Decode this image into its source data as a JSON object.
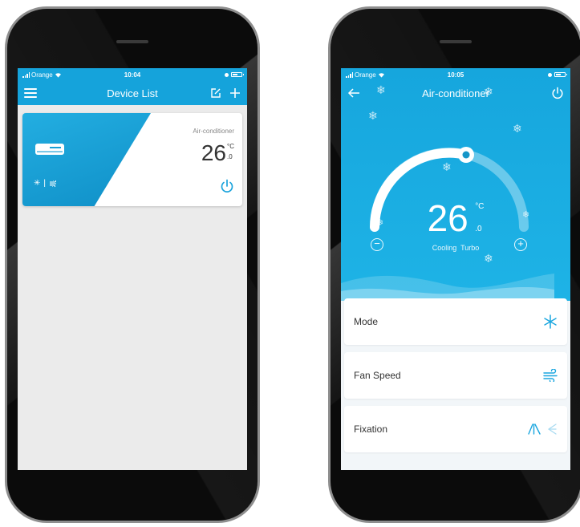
{
  "device_list_screen": {
    "status": {
      "carrier": "Orange",
      "time": "10:04"
    },
    "nav": {
      "title": "Device List"
    },
    "device_card": {
      "name": "Air-conditioner",
      "temp": "26",
      "unit": "°C",
      "decimal": ".0",
      "modes_separator": "|"
    }
  },
  "detail_screen": {
    "status": {
      "carrier": "Orange",
      "time": "10:05"
    },
    "nav": {
      "title": "Air-conditioner"
    },
    "thermostat": {
      "temp": "26",
      "unit": "°C",
      "decimal": ".0",
      "mode_text": "Cooling  Turbo",
      "decrease_label": "−",
      "increase_label": "+"
    },
    "settings": [
      {
        "label": "Mode",
        "icon": "snowflake-icon"
      },
      {
        "label": "Fan Speed",
        "icon": "wind-icon"
      },
      {
        "label": "Fixation",
        "icon": "swing-icon"
      }
    ]
  },
  "colors": {
    "accent": "#15a3db",
    "card_background": "#ffffff",
    "list_background": "#ebebeb"
  }
}
